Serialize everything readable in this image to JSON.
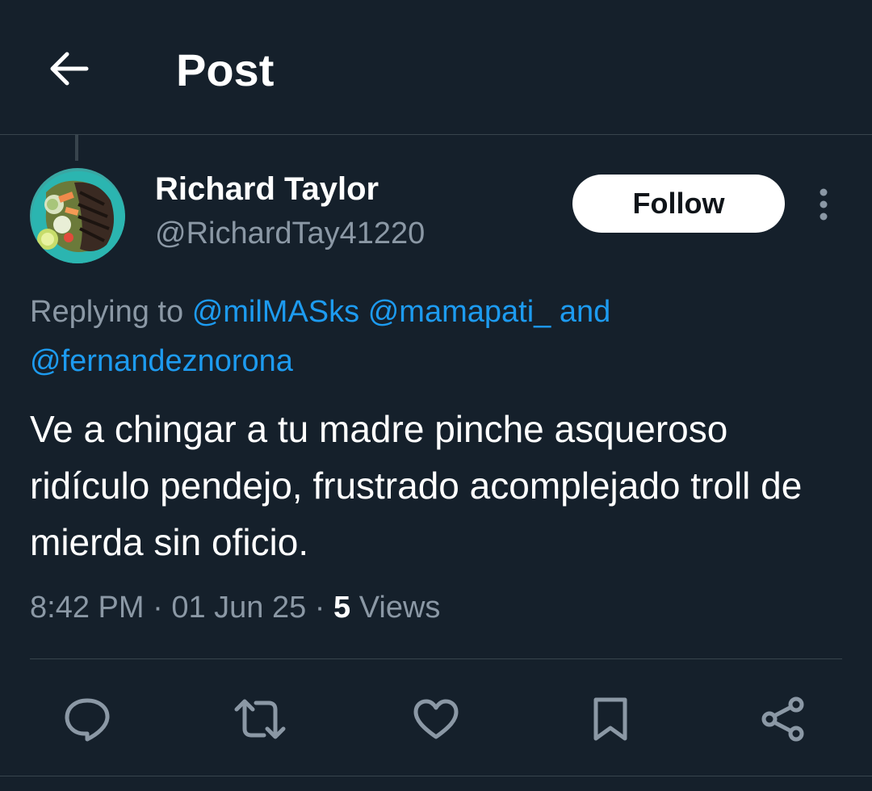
{
  "header": {
    "title": "Post",
    "back_icon": "arrow-left-icon"
  },
  "tweet": {
    "author": {
      "name": "Richard Taylor",
      "handle": "@RichardTay41220",
      "avatar": "food-plate-avatar"
    },
    "follow_label": "Follow",
    "more_icon": "more-vertical-icon",
    "reply": {
      "prefix": "Replying to",
      "mention_1": "@milMASks",
      "mention_2": "@mamapati_",
      "conjunction": "and",
      "mention_3": "@fernandeznorona"
    },
    "text": "Ve a chingar a tu madre pinche asqueroso ridículo pendejo, frustrado acomplejado troll de mierda sin oficio.",
    "time": "8:42 PM",
    "separator": "·",
    "date": "01 Jun 25",
    "views_count": "5",
    "views_label": "Views"
  },
  "actions": [
    "reply-icon",
    "retweet-icon",
    "like-icon",
    "bookmark-icon",
    "share-icon"
  ],
  "colors": {
    "background": "#15202b",
    "border": "#38444d",
    "secondary_text": "#8b98a5",
    "accent": "#1d9bf0",
    "text": "#ffffff"
  }
}
